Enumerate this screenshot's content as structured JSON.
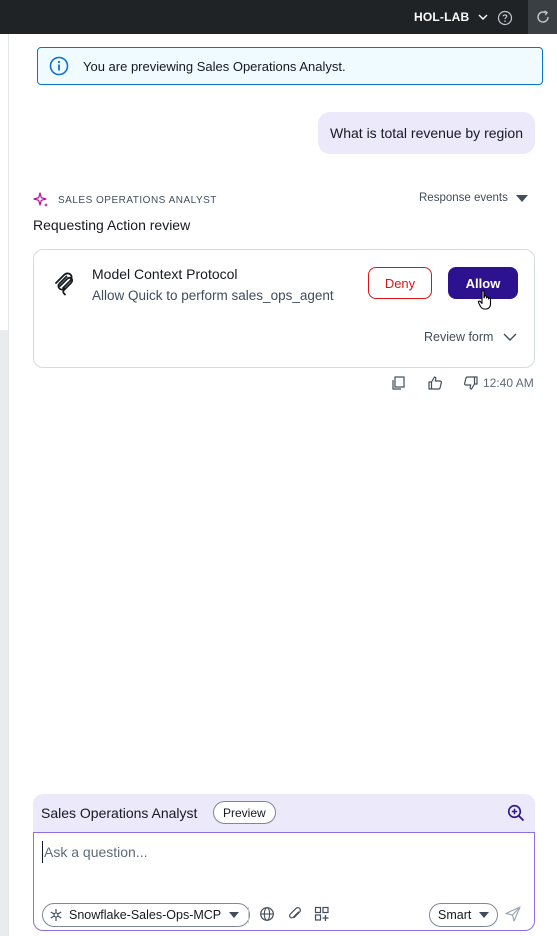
{
  "topbar": {
    "account_label": "HOL-LAB",
    "icons": [
      "chevron-down-icon",
      "help-icon",
      "refresh-icon"
    ]
  },
  "banner": {
    "icon": "info-icon",
    "text": "You are previewing Sales Operations Analyst."
  },
  "conversation": {
    "user_message": "What is total revenue by region",
    "agent_name": "SALES OPERATIONS ANALYST",
    "response_events_label": "Response events",
    "request_title": "Requesting Action review",
    "action_card": {
      "icon": "mcp-icon",
      "title": "Model Context Protocol",
      "description": "Allow Quick to perform sales_ops_agent",
      "deny_label": "Deny",
      "allow_label": "Allow",
      "review_form_label": "Review form"
    },
    "feedback": {
      "icons": [
        "copy-icon",
        "thumbs-up-icon",
        "thumbs-down-icon"
      ],
      "timestamp": "12:40 AM"
    }
  },
  "composer": {
    "agent_name": "Sales Operations Analyst",
    "badge": "Preview",
    "input_placeholder": "Ask a question...",
    "input_value": "",
    "mcp_selector": "Snowflake-Sales-Ops-MCP",
    "mode_selector": "Smart",
    "tool_icons": [
      "globe-icon",
      "attach-icon",
      "add-widget-icon"
    ]
  },
  "colors": {
    "topbar_bg": "#1f2326",
    "banner_border": "#0972d3",
    "banner_bg": "#f0fbff",
    "bubble_bg": "#ece9fb",
    "allow_bg": "#2d128f",
    "deny_color": "#d91515",
    "accent_purple": "#8c6fe8"
  }
}
